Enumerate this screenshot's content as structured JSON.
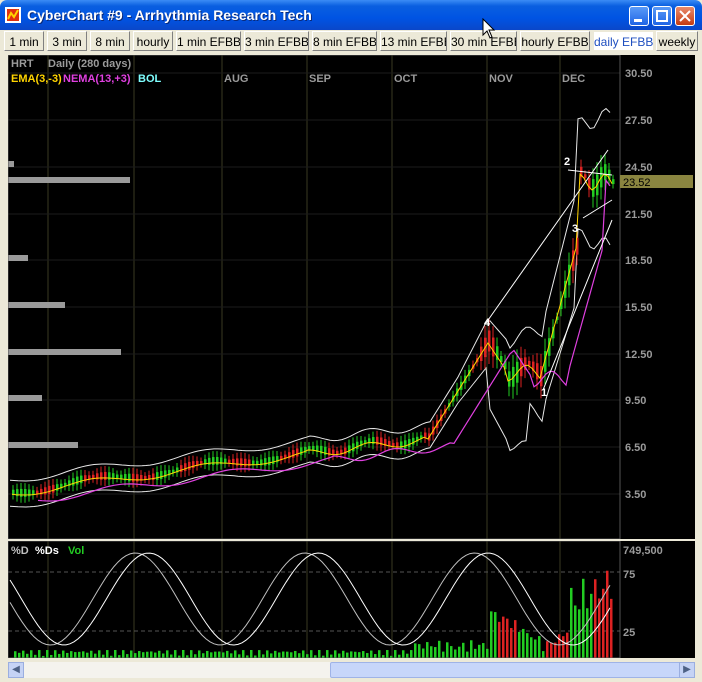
{
  "window": {
    "title": "CyberChart #9 - Arrhythmia Research Tech"
  },
  "tabs": [
    {
      "label": "1 min"
    },
    {
      "label": "3 min"
    },
    {
      "label": "8 min"
    },
    {
      "label": "hourly"
    },
    {
      "label": "1 min EFBB"
    },
    {
      "label": "3 min EFBB"
    },
    {
      "label": "8 min EFBB"
    },
    {
      "label": "13 min EFBB"
    },
    {
      "label": "30 min EFBB"
    },
    {
      "label": "hourly EFBB"
    },
    {
      "label": "daily EFBB"
    },
    {
      "label": "weekly"
    }
  ],
  "chart": {
    "symbol": "HRT",
    "period": "Daily (280 days)",
    "legend": [
      {
        "label": "EMA(3,-3)",
        "color": "#ffd400"
      },
      {
        "label": "NEMA(13,+3)",
        "color": "#e040e0"
      },
      {
        "label": "BOL",
        "color": "#7fffff"
      }
    ],
    "months": [
      "AUG",
      "SEP",
      "OCT",
      "NOV",
      "DEC"
    ],
    "price_axis": [
      "30.50",
      "27.50",
      "24.50",
      "21.50",
      "18.50",
      "15.50",
      "12.50",
      "9.50",
      "6.50",
      "3.50"
    ],
    "last_price": "23.52",
    "wave_labels": [
      "4",
      "1",
      "2",
      "3"
    ],
    "indicator_legend": [
      {
        "label": "%D",
        "color": "#c0c0c0"
      },
      {
        "label": "%Ds",
        "color": "#ffffff"
      },
      {
        "label": "Vol",
        "color": "#22cc22"
      }
    ],
    "indicator_axis": [
      "749,500",
      "75",
      "25"
    ]
  }
}
